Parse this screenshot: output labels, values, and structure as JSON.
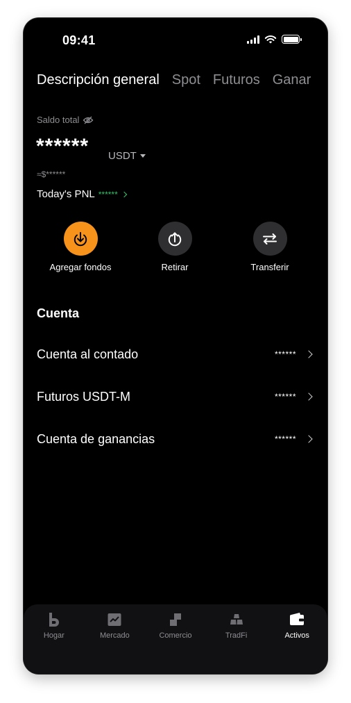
{
  "status_bar": {
    "time": "09:41"
  },
  "tabs": [
    {
      "label": "Descripción general",
      "active": true
    },
    {
      "label": "Spot",
      "active": false
    },
    {
      "label": "Futuros",
      "active": false
    },
    {
      "label": "Ganar",
      "active": false
    }
  ],
  "balance": {
    "label": "Saldo total",
    "hidden_value": "******",
    "currency": "USDT",
    "approx": "≈$******",
    "pnl_label": "Today's PNL",
    "pnl_value": "******"
  },
  "actions": [
    {
      "label": "Agregar fondos",
      "icon": "deposit-icon"
    },
    {
      "label": "Retirar",
      "icon": "withdraw-icon"
    },
    {
      "label": "Transferir",
      "icon": "transfer-icon"
    }
  ],
  "account": {
    "title": "Cuenta",
    "rows": [
      {
        "label": "Cuenta al contado",
        "value": "******"
      },
      {
        "label": "Futuros USDT-M",
        "value": "******"
      },
      {
        "label": "Cuenta de ganancias",
        "value": "******"
      }
    ]
  },
  "nav": [
    {
      "label": "Hogar",
      "icon": "home-icon",
      "active": false
    },
    {
      "label": "Mercado",
      "icon": "market-chart-icon",
      "active": false
    },
    {
      "label": "Comercio",
      "icon": "trade-icon",
      "active": false
    },
    {
      "label": "TradFi",
      "icon": "gold-bars-icon",
      "active": false
    },
    {
      "label": "Activos",
      "icon": "wallet-icon",
      "active": true
    }
  ],
  "colors": {
    "accent": "#f7931a",
    "positive": "#31c26a",
    "background": "#000000"
  }
}
